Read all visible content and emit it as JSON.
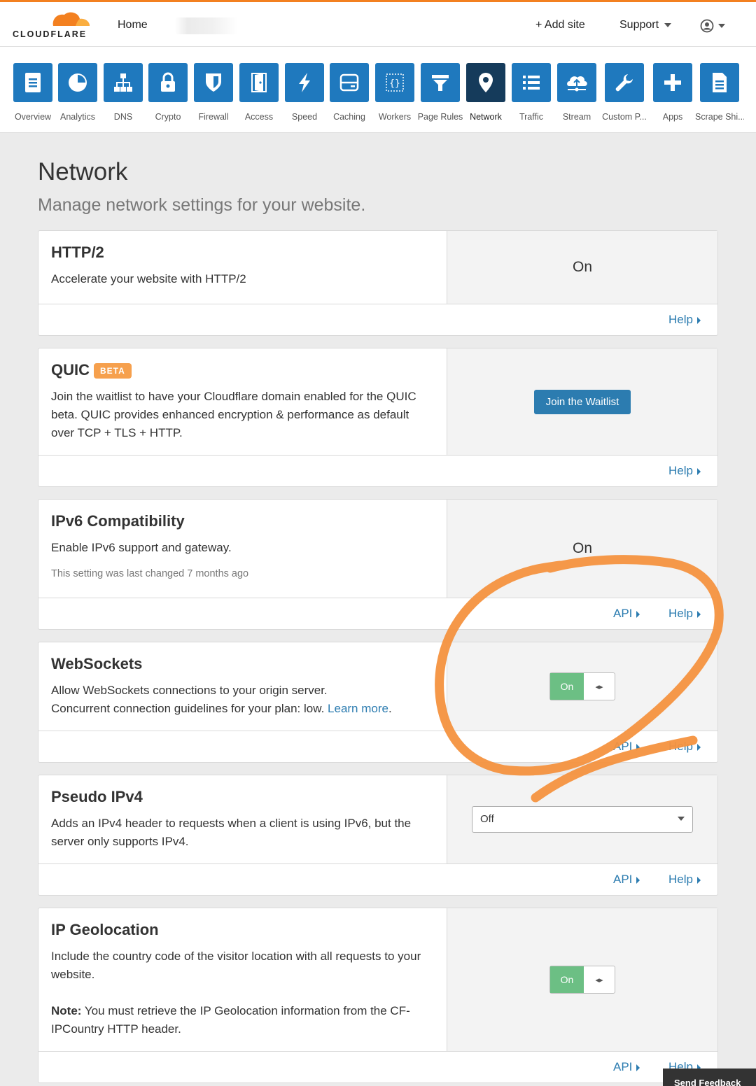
{
  "header": {
    "logo_text": "CLOUDFLARE",
    "home": "Home",
    "add_site": "+ Add site",
    "support": "Support",
    "colors": {
      "accent": "#f38020",
      "brand_blue": "#1f79be"
    }
  },
  "apps": [
    {
      "label": "Overview",
      "icon": "document-icon"
    },
    {
      "label": "Analytics",
      "icon": "pie-chart-icon"
    },
    {
      "label": "DNS",
      "icon": "network-tree-icon"
    },
    {
      "label": "Crypto",
      "icon": "lock-icon"
    },
    {
      "label": "Firewall",
      "icon": "shield-icon"
    },
    {
      "label": "Access",
      "icon": "door-icon"
    },
    {
      "label": "Speed",
      "icon": "lightning-icon"
    },
    {
      "label": "Caching",
      "icon": "server-icon"
    },
    {
      "label": "Workers",
      "icon": "braces-icon"
    },
    {
      "label": "Page Rules",
      "icon": "filter-icon"
    },
    {
      "label": "Network",
      "icon": "location-pin-icon",
      "active": true
    },
    {
      "label": "Traffic",
      "icon": "list-icon"
    },
    {
      "label": "Stream",
      "icon": "cloud-upload-icon"
    },
    {
      "label": "Custom P...",
      "icon": "wrench-icon"
    },
    {
      "label": "Apps",
      "icon": "plus-icon"
    },
    {
      "label": "Scrape Shi...",
      "icon": "file-icon"
    }
  ],
  "page": {
    "title": "Network",
    "subtitle": "Manage network settings for your website."
  },
  "cards": {
    "http2": {
      "title": "HTTP/2",
      "desc": "Accelerate your website with HTTP/2",
      "status": "On",
      "help": "Help"
    },
    "quic": {
      "title": "QUIC",
      "badge": "BETA",
      "desc": "Join the waitlist to have your Cloudflare domain enabled for the QUIC beta. QUIC provides enhanced encryption & performance as default over TCP + TLS + HTTP.",
      "button": "Join the Waitlist",
      "help": "Help"
    },
    "ipv6": {
      "title": "IPv6 Compatibility",
      "desc": "Enable IPv6 support and gateway.",
      "changed": "This setting was last changed 7 months ago",
      "status": "On",
      "api": "API",
      "help": "Help"
    },
    "websockets": {
      "title": "WebSockets",
      "desc_line1": "Allow WebSockets connections to your origin server.",
      "desc_line2": "Concurrent connection guidelines for your plan: low.",
      "learn_more": "Learn more",
      "period": ".",
      "toggle": "On",
      "toggle_knob": "◂▸",
      "api": "API",
      "help": "Help"
    },
    "pseudo_ipv4": {
      "title": "Pseudo IPv4",
      "desc": "Adds an IPv4 header to requests when a client is using IPv6, but the server only supports IPv4.",
      "select_value": "Off",
      "api": "API",
      "help": "Help"
    },
    "ip_geolocation": {
      "title": "IP Geolocation",
      "desc": "Include the country code of the visitor location with all requests to your website.",
      "note_label": "Note:",
      "note": " You must retrieve the IP Geolocation information from the CF-IPCountry HTTP header.",
      "toggle": "On",
      "toggle_knob": "◂▸",
      "api": "API",
      "help": "Help"
    }
  },
  "feedback": "Send Feedback"
}
